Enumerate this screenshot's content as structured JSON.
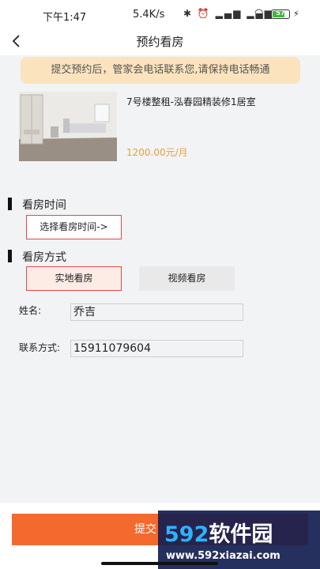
{
  "status_bar": {
    "time": "下午1:47",
    "network_speed": "5.4K/s",
    "icons": [
      "bluetooth-icon",
      "alarm-icon",
      "signal-icon",
      "signal-icon",
      "wifi-icon",
      "battery-icon",
      "charging-icon"
    ],
    "battery": "57"
  },
  "nav": {
    "back_icon": "chevron-left-icon",
    "title": "预约看房"
  },
  "notice": "提交预约后，管家会电话联系您,请保持电话畅通",
  "listing": {
    "title": "7号楼整租-泓春园精装修1居室",
    "price": "1200.00元/月"
  },
  "viewing_time": {
    "heading": "看房时间",
    "button": "选择看房时间->"
  },
  "viewing_mode": {
    "heading": "看房方式",
    "options": [
      "实地看房",
      "视频看房"
    ],
    "selected": "实地看房"
  },
  "form": {
    "name_label": "姓名:",
    "name_value": "乔吉",
    "phone_label": "联系方式:",
    "phone_value": "15911079604"
  },
  "submit_label": "提交",
  "watermark": {
    "logo_number": "592",
    "logo_text": "软件园",
    "url": "www.592xiazai.com"
  },
  "colors": {
    "accent": "#f4692e",
    "price": "#e8a13b",
    "notice_bg": "#fbe3bd",
    "selected_border": "#e34a4a"
  }
}
